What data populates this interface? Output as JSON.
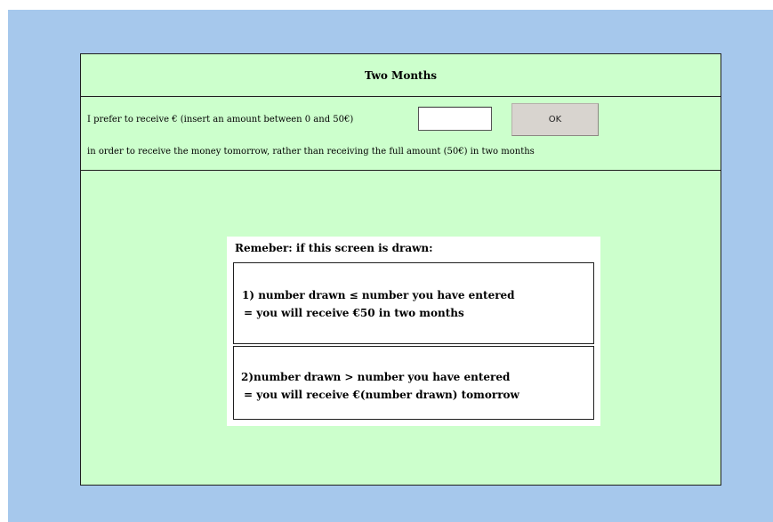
{
  "header": {
    "title": "Two Months"
  },
  "question": {
    "line1": "I prefer to receive € (insert an amount between 0 and 50€)",
    "input_value": "",
    "ok_label": "OK",
    "line2": "in order to receive the money tomorrow, rather than receiving the full amount (50€) in two months"
  },
  "reminder": {
    "title": "Remeber: if this screen is drawn:",
    "case1": {
      "line1": "1) number drawn  ≤ number you have entered",
      "line2": "= you will receive €50 in two months"
    },
    "case2": {
      "line1": "2)number drawn  > number you have entered",
      "line2": "= you will receive €(number drawn) tomorrow"
    }
  },
  "colors": {
    "background": "#a6c8ec",
    "panel": "#ccffcc",
    "button": "#d8d4cf"
  }
}
